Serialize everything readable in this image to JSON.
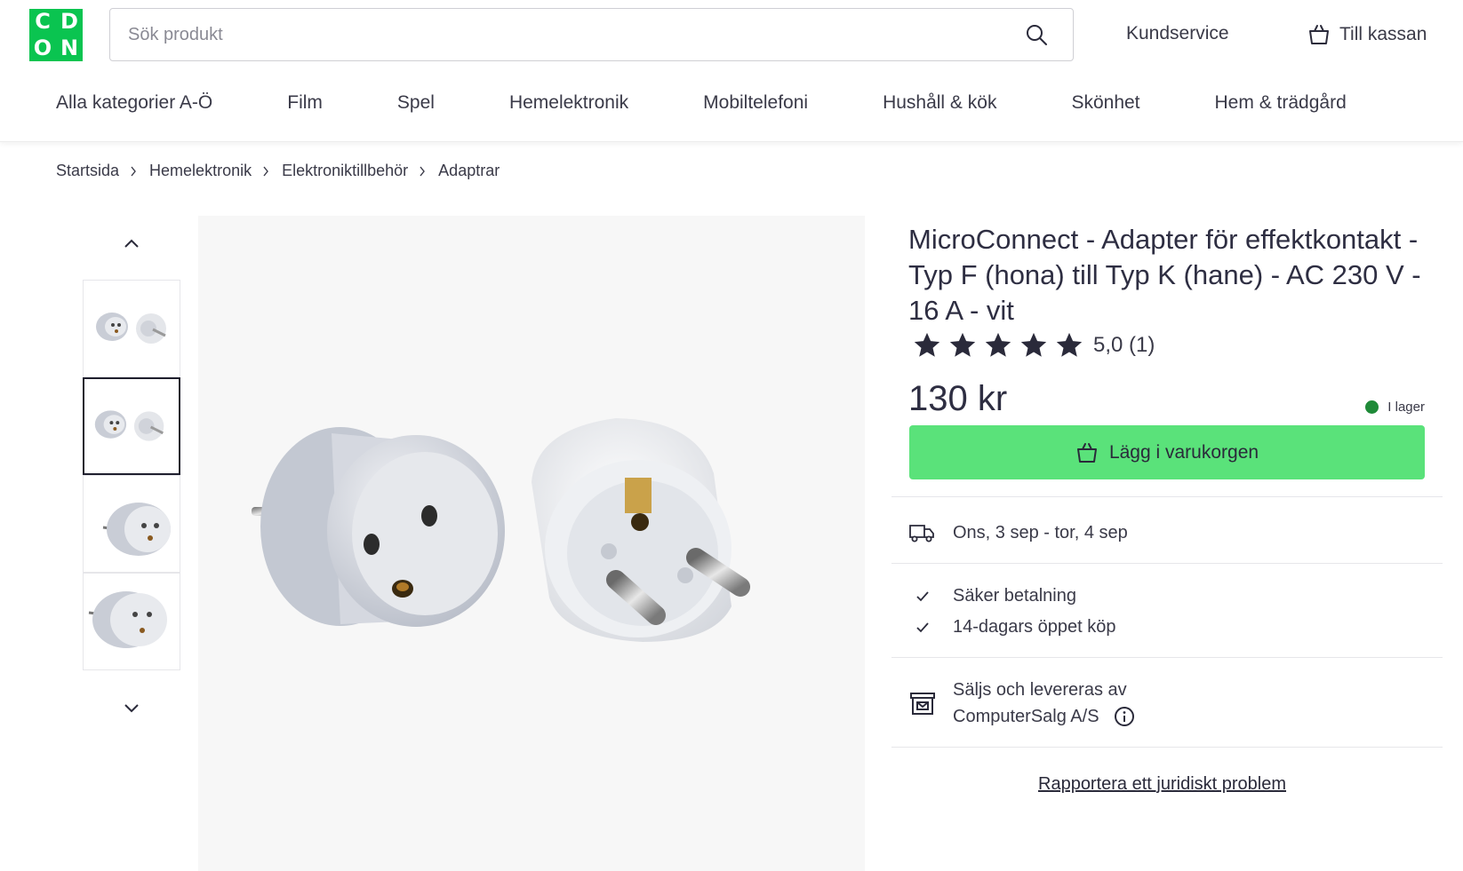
{
  "header": {
    "logo_letters": [
      "C",
      "D",
      "O",
      "N"
    ],
    "search_placeholder": "Sök produkt",
    "customer_service": "Kundservice",
    "checkout": "Till kassan"
  },
  "nav": {
    "items": [
      "Alla kategorier A-Ö",
      "Film",
      "Spel",
      "Hemelektronik",
      "Mobiltelefoni",
      "Hushåll & kök",
      "Skönhet",
      "Hem & trädgård"
    ]
  },
  "breadcrumb": [
    "Startsida",
    "Hemelektronik",
    "Elektroniktillbehör",
    "Adaptrar"
  ],
  "gallery": {
    "thumbnail_count": 4,
    "active_index": 1
  },
  "product": {
    "title": "MicroConnect - Adapter för effektkontakt - Typ F (hona) till Typ K (hane) - AC 230 V - 16 A - vit",
    "rating_stars": 5,
    "rating_text": "5,0 (1)",
    "price": "130 kr",
    "stock": "I lager",
    "stock_color": "#1f8a38",
    "add_to_cart": "Lägg i varukorgen",
    "cart_button_color": "#5ae27a"
  },
  "delivery": {
    "date_range": "Ons, 3 sep - tor, 4 sep"
  },
  "benefits": [
    "Säker betalning",
    "14-dagars öppet köp"
  ],
  "seller": {
    "line1": "Säljs och levereras av",
    "name": "ComputerSalg A/S"
  },
  "report_link": "Rapportera ett juridiskt problem",
  "colors": {
    "brand": "#0ac450",
    "text": "#2a2a3a"
  }
}
